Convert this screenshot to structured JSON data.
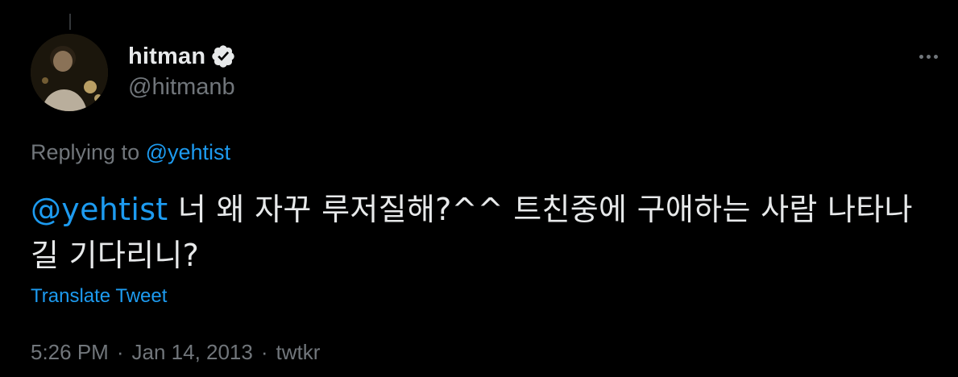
{
  "tweet": {
    "author": {
      "display_name": "hitman",
      "handle": "@hitmanb",
      "verified": true,
      "avatar_icon": "user-avatar"
    },
    "reply": {
      "prefix": "Replying to",
      "to_handle": "@yehtist"
    },
    "text": {
      "mention": "@yehtist",
      "body": " 너 왜 자꾸 루저질해?^^ 트친중에 구애하는 사람 나타나길 기다리니?"
    },
    "translate_label": "Translate Tweet",
    "meta": {
      "time": "5:26 PM",
      "separator": "·",
      "date": "Jan 14, 2013",
      "source": "twtkr"
    },
    "more_icon": "more-horizontal-icon"
  },
  "colors": {
    "background": "#000000",
    "text": "#e7e9ea",
    "secondary": "#71767b",
    "accent": "#1d9bf0"
  }
}
